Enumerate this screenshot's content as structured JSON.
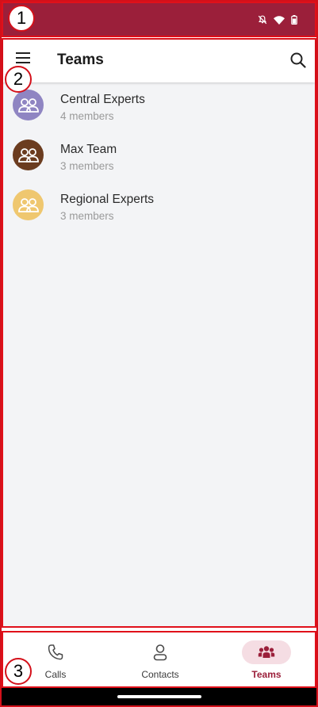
{
  "annotations": [
    "1",
    "2",
    "3"
  ],
  "status_bar": {
    "icons": [
      "notifications-off-icon",
      "wifi-icon",
      "battery-icon"
    ],
    "background": "#9b1f3a"
  },
  "app_bar": {
    "title": "Teams",
    "menu_icon": "hamburger-menu-icon",
    "search_icon": "search-icon"
  },
  "teams": [
    {
      "name": "Central Experts",
      "members": "4 members",
      "color": "#8f85c2",
      "icon": "group-icon"
    },
    {
      "name": "Max Team",
      "members": "3 members",
      "color": "#6b3c1f",
      "icon": "group-icon"
    },
    {
      "name": "Regional Experts",
      "members": "3 members",
      "color": "#efc76f",
      "icon": "group-icon"
    }
  ],
  "bottom_nav": {
    "items": [
      {
        "label": "Calls",
        "icon": "phone-icon",
        "active": false
      },
      {
        "label": "Contacts",
        "icon": "person-icon",
        "active": false
      },
      {
        "label": "Teams",
        "icon": "group-icon",
        "active": true
      }
    ]
  },
  "colors": {
    "accent": "#9b1f3a",
    "annotation": "#d4101a"
  }
}
